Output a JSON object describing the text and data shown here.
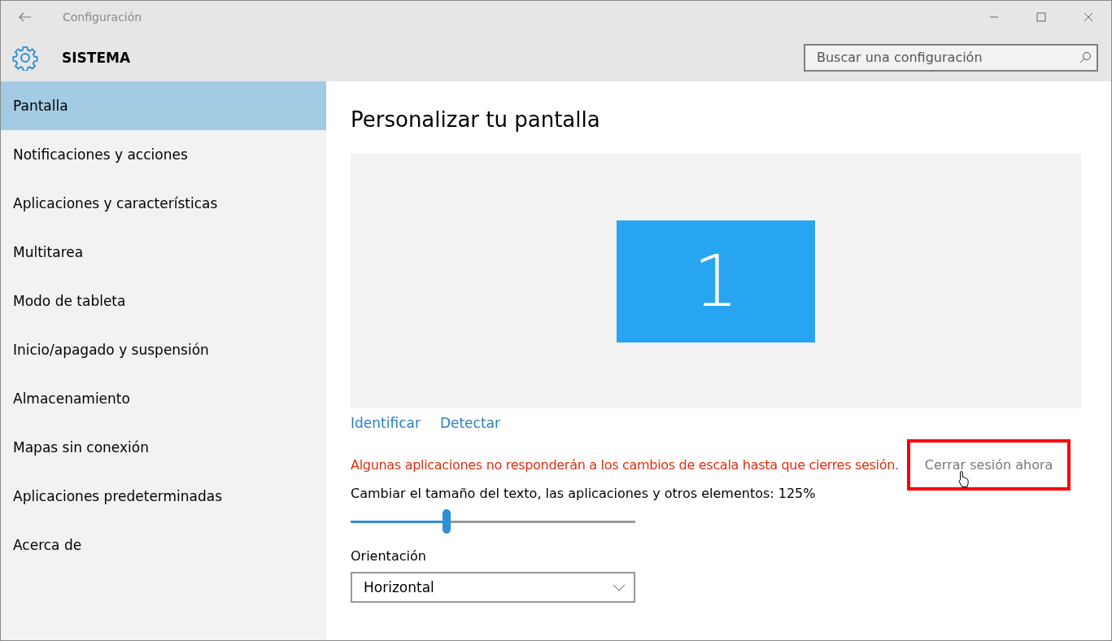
{
  "window": {
    "title": "Configuración"
  },
  "header": {
    "title": "SISTEMA",
    "search": {
      "placeholder": "Buscar una configuración"
    }
  },
  "sidebar": {
    "items": [
      {
        "label": "Pantalla",
        "selected": true
      },
      {
        "label": "Notificaciones y acciones",
        "selected": false
      },
      {
        "label": "Aplicaciones y características",
        "selected": false
      },
      {
        "label": "Multitarea",
        "selected": false
      },
      {
        "label": "Modo de tableta",
        "selected": false
      },
      {
        "label": "Inicio/apagado y suspensión",
        "selected": false
      },
      {
        "label": "Almacenamiento",
        "selected": false
      },
      {
        "label": "Mapas sin conexión",
        "selected": false
      },
      {
        "label": "Aplicaciones predeterminadas",
        "selected": false
      },
      {
        "label": "Acerca de",
        "selected": false
      }
    ]
  },
  "content": {
    "title": "Personalizar tu pantalla",
    "monitor": "1",
    "links": [
      "Identificar",
      "Detectar"
    ],
    "warning": "Algunas aplicaciones no responderán a los cambios de escala hasta que cierres sesión.",
    "signout": {
      "label": "Cerrar sesión ahora",
      "highlighted": true
    },
    "scale": {
      "label": "Cambiar el tamaño del texto, las aplicaciones y otros elementos: 125%",
      "level": 0.34
    },
    "orientation": {
      "label": "Orientación",
      "value": "Horizontal"
    }
  }
}
